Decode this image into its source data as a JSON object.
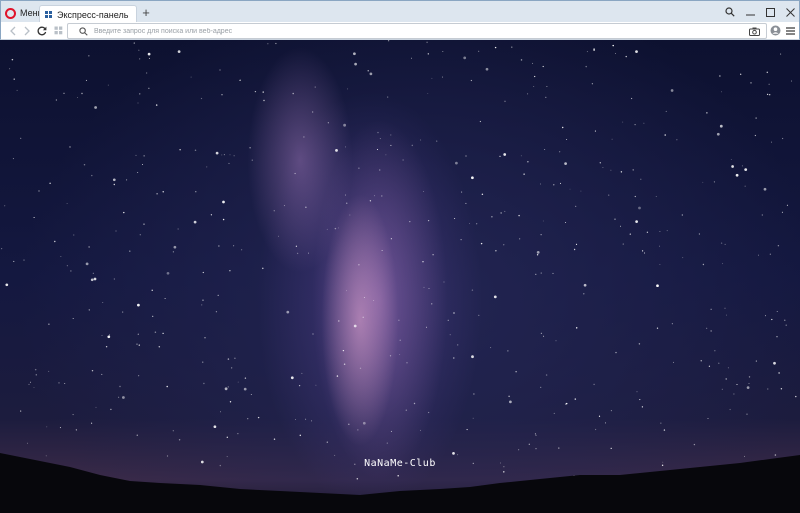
{
  "browser": {
    "menu_label": "Меню",
    "tab_title": "Экспресс-панель",
    "new_tab_symbol": "+",
    "address_placeholder": "Введите запрос для поиска или веб-адрес",
    "address_value": ""
  },
  "watermark": "NaNaMe-Club",
  "colors": {
    "opera_red": "#e0132a",
    "titlebar": "#dde6ef",
    "tab_icon_blue": "#2a5f9e"
  },
  "icons": [
    "opera-logo-icon",
    "speed-dial-grid-icon",
    "search-icon",
    "back-arrow-icon",
    "forward-arrow-icon",
    "reload-icon",
    "speed-dial-shortcut-icon",
    "camera-icon",
    "account-icon",
    "hamburger-menu-icon",
    "minimize-icon",
    "maximize-icon",
    "close-icon"
  ]
}
